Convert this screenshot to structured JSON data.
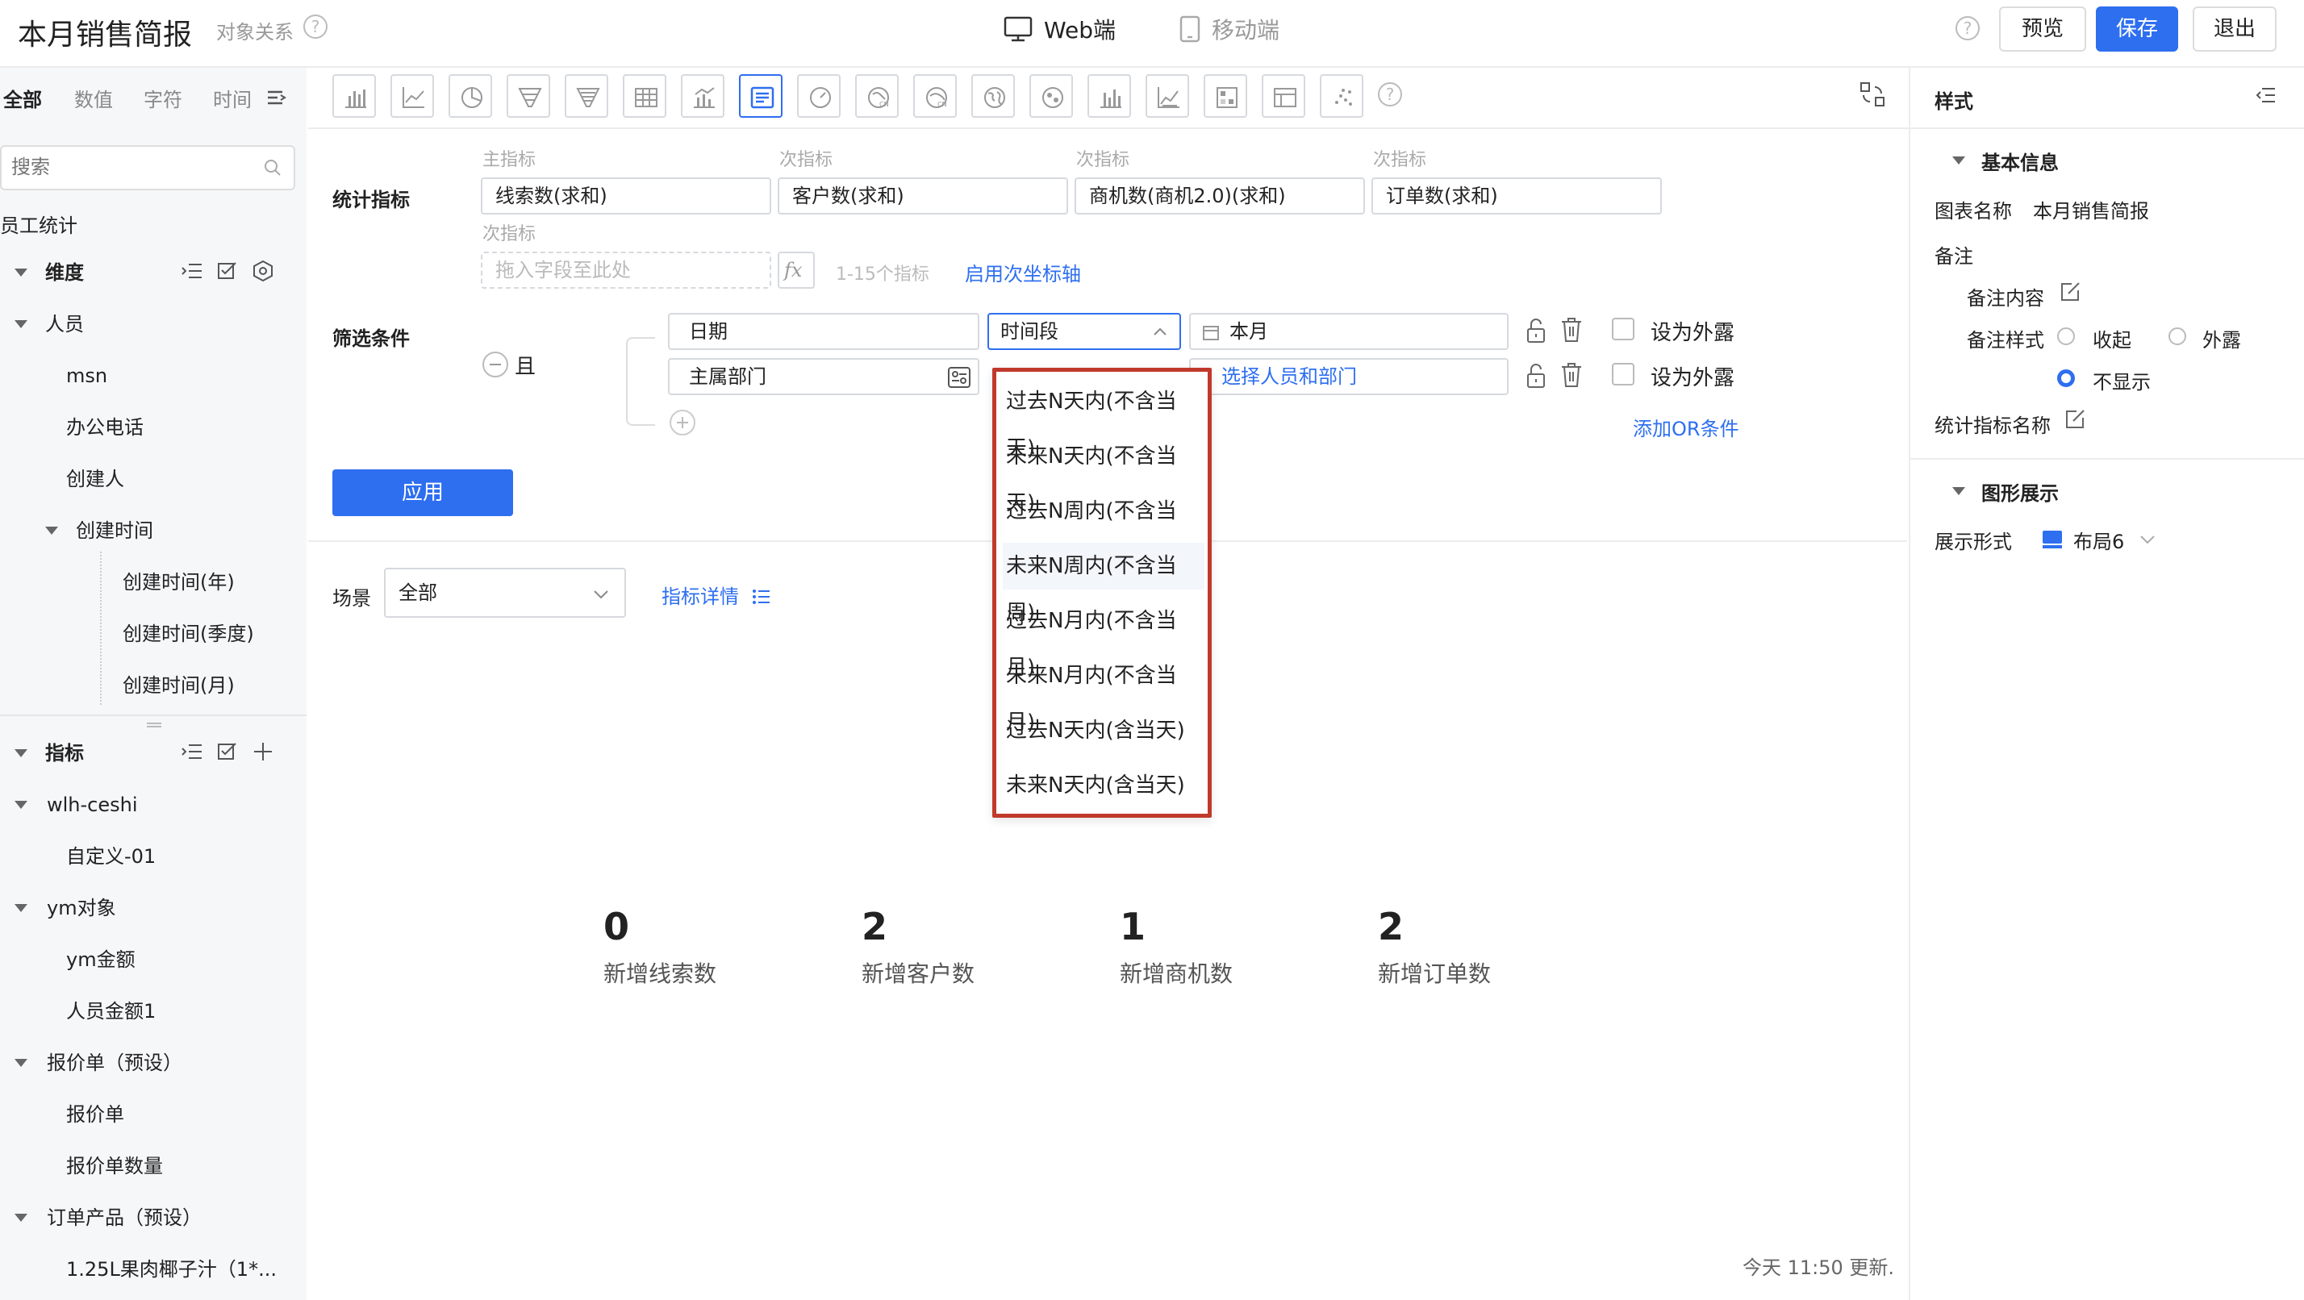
{
  "header": {
    "title": "本月销售简报",
    "subtitle": "对象关系",
    "web_tab": "Web端",
    "mobile_tab": "移动端",
    "preview": "预览",
    "save": "保存",
    "exit": "退出"
  },
  "left": {
    "tabs": [
      "全部",
      "数值",
      "字符",
      "时间"
    ],
    "search_placeholder": "搜索",
    "dataset": "员工统计",
    "dimension_header": "维度",
    "dimension_items": [
      "人员",
      "msn",
      "办公电话",
      "创建人",
      "创建时间",
      "创建时间(年)",
      "创建时间(季度)",
      "创建时间(月)"
    ],
    "metric_header": "指标",
    "metric_items": [
      "wlh-ceshi",
      "自定义-01",
      "ym对象",
      "ym金额",
      "人员金额1",
      "报价单（预设）",
      "报价单",
      "报价单数量",
      "订单产品（预设）",
      "1.25L果肉椰子汁（1*..."
    ]
  },
  "config": {
    "stat_label": "统计指标",
    "primary_label": "主指标",
    "secondary_label": "次指标",
    "metrics": [
      "线索数(求和)",
      "客户数(求和)",
      "商机数(商机2.0)(求和)",
      "订单数(求和)"
    ],
    "drop_placeholder": "拖入字段至此处",
    "fx": "fx",
    "limit_hint": "1-15个指标",
    "secondary_axis": "启用次坐标轴",
    "filter_label": "筛选条件",
    "logic": "且",
    "filter1_field": "日期",
    "filter1_op": "时间段",
    "filter1_value": "本月",
    "filter2_field": "主属部门",
    "filter2_value": "选择人员和部门",
    "expose": "设为外露",
    "add_or": "添加OR条件",
    "apply": "应用",
    "scene_label": "场景",
    "scene_value": "全部",
    "metric_detail": "指标详情"
  },
  "dropdown": {
    "options": [
      "过去N天内(不含当天)",
      "未来N天内(不含当天)",
      "过去N周内(不含当周)",
      "未来N周内(不含当周)",
      "过去N月内(不含当月)",
      "未来N月内(不含当月)",
      "过去N天内(含当天)",
      "未来N天内(含当天)"
    ]
  },
  "metrics_display": [
    {
      "value": "0",
      "label": "新增线索数"
    },
    {
      "value": "2",
      "label": "新增客户数"
    },
    {
      "value": "1",
      "label": "新增商机数"
    },
    {
      "value": "2",
      "label": "新增订单数"
    }
  ],
  "updated": "今天 11:50 更新.",
  "right": {
    "title": "样式",
    "basic_info": "基本信息",
    "chart_name_label": "图表名称",
    "chart_name_value": "本月销售简报",
    "remark": "备注",
    "remark_content": "备注内容",
    "remark_style": "备注样式",
    "collapse": "收起",
    "expose": "外露",
    "hide": "不显示",
    "stat_name": "统计指标名称",
    "graphic": "图形展示",
    "display_form": "展示形式",
    "layout_value": "布局6"
  },
  "colors": {
    "accent": "#2e6ff0",
    "highlight_border": "#c0392b"
  }
}
